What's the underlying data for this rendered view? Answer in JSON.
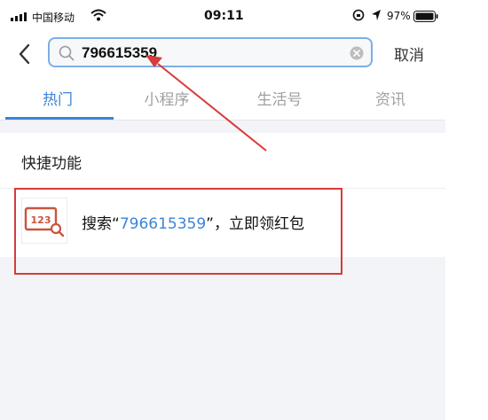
{
  "status_bar": {
    "carrier": "中国移动",
    "time": "09:11",
    "battery": "97%"
  },
  "search": {
    "query": "796615359",
    "cancel_label": "取消"
  },
  "tabs": [
    {
      "label": "热门",
      "active": true
    },
    {
      "label": "小程序",
      "active": false
    },
    {
      "label": "生活号",
      "active": false
    },
    {
      "label": "资讯",
      "active": false
    }
  ],
  "quick_functions": {
    "title": "快捷功能",
    "item": {
      "prefix": "搜索“",
      "number": "796615359",
      "suffix": "”，立即领红包",
      "icon_text": "123"
    }
  },
  "colors": {
    "accent": "#3c85d6",
    "annotation": "#d93a3a",
    "background": "#f3f4f8"
  }
}
